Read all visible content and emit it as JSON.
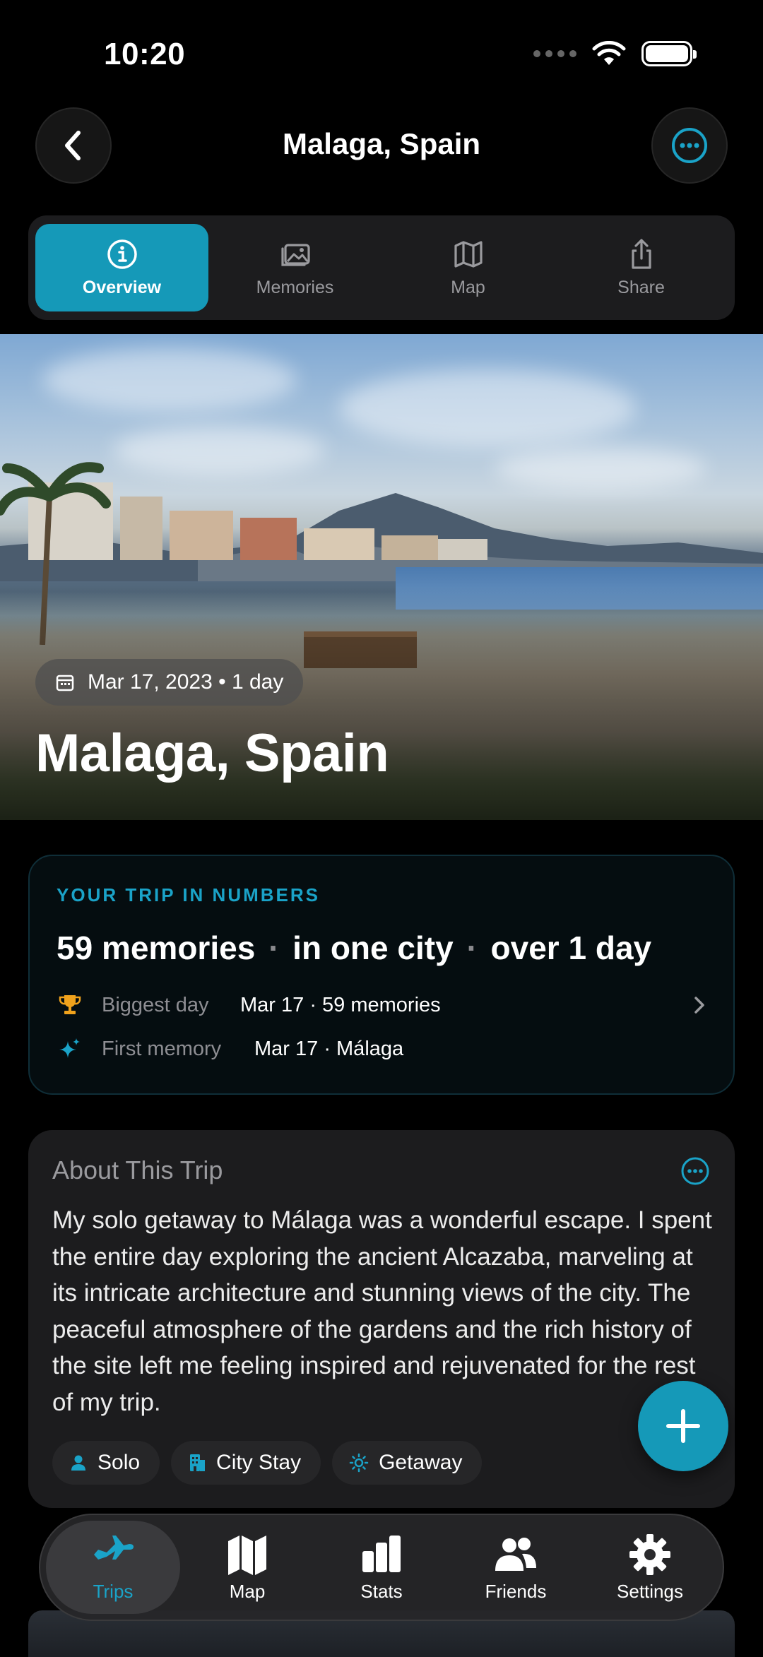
{
  "status_bar": {
    "time": "10:20"
  },
  "header": {
    "title": "Malaga, Spain"
  },
  "segments": [
    {
      "label": "Overview",
      "icon": "info-icon",
      "active": true
    },
    {
      "label": "Memories",
      "icon": "photos-icon",
      "active": false
    },
    {
      "label": "Map",
      "icon": "map-icon",
      "active": false
    },
    {
      "label": "Share",
      "icon": "share-icon",
      "active": false
    }
  ],
  "hero": {
    "date_text": "Mar 17, 2023 • 1 day",
    "title": "Malaga, Spain"
  },
  "numbers": {
    "eyebrow": "YOUR TRIP IN NUMBERS",
    "memories": "59 memories",
    "cities": "in one city",
    "duration": "over 1 day",
    "separator": "·",
    "rows": [
      {
        "label": "Biggest day",
        "value": "Mar 17 · 59 memories",
        "icon": "trophy-icon"
      },
      {
        "label": "First memory",
        "value": "Mar 17 · Málaga",
        "icon": "sparkles-icon"
      }
    ]
  },
  "about": {
    "title": "About This Trip",
    "body": "My solo getaway to Málaga was a wonderful escape. I spent the entire day exploring the ancient Alcazaba, marveling at its intricate architecture and stunning views of the city. The peaceful atmosphere of the gardens and the rich history of the site left me feeling inspired and rejuvenated for the rest of my trip.",
    "tags": [
      {
        "label": "Solo",
        "icon": "person-icon"
      },
      {
        "label": "City Stay",
        "icon": "building-icon"
      },
      {
        "label": "Getaway",
        "icon": "sun-icon"
      }
    ]
  },
  "tabbar": [
    {
      "label": "Trips",
      "icon": "airplane-icon",
      "active": true
    },
    {
      "label": "Map",
      "icon": "map-icon",
      "active": false
    },
    {
      "label": "Stats",
      "icon": "bar-chart-icon",
      "active": false
    },
    {
      "label": "Friends",
      "icon": "people-icon",
      "active": false
    },
    {
      "label": "Settings",
      "icon": "gear-icon",
      "active": false
    }
  ],
  "colors": {
    "accent": "#1599b8",
    "background": "#000000",
    "card": "#1c1c1e"
  }
}
